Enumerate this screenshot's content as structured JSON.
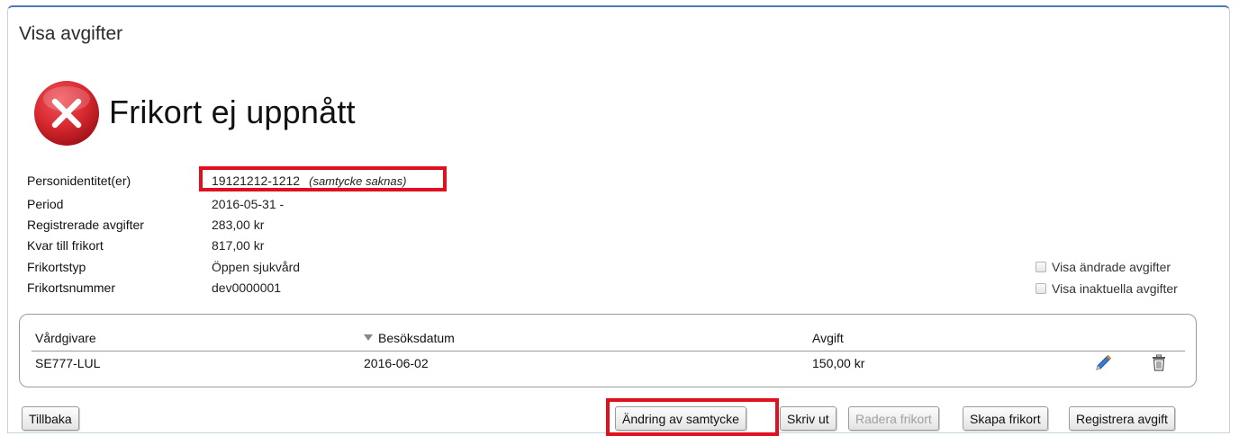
{
  "window": {
    "title": "Visa avgifter"
  },
  "status": {
    "title": "Frikort ej uppnått",
    "icon": "error-x-icon",
    "color": "#d7282f"
  },
  "info": {
    "rows": [
      {
        "label": "Personidentitet(er)",
        "value": "19121212-1212",
        "note": "(samtycke saknas)"
      },
      {
        "label": "Period",
        "value": "2016-05-31 -"
      },
      {
        "label": "Registrerade avgifter",
        "value": "283,00 kr"
      },
      {
        "label": "Kvar till frikort",
        "value": "817,00 kr"
      },
      {
        "label": "Frikortstyp",
        "value": "Öppen sjukvård"
      },
      {
        "label": "Frikortsnummer",
        "value": "dev0000001"
      }
    ]
  },
  "filters": {
    "show_changed": {
      "label": "Visa ändrade avgifter",
      "checked": false
    },
    "show_inactive": {
      "label": "Visa inaktuella avgifter",
      "checked": false
    }
  },
  "table": {
    "columns": [
      "Vårdgivare",
      "Besöksdatum",
      "Avgift"
    ],
    "sorted_column": "Besöksdatum",
    "rows": [
      {
        "provider": "SE777-LUL",
        "date": "2016-06-02",
        "fee": "150,00 kr",
        "actions": [
          "edit-pencil-icon",
          "delete-trash-icon"
        ]
      }
    ]
  },
  "buttons": {
    "back": "Tillbaka",
    "consent_change": "Ändring av samtycke",
    "print": "Skriv ut",
    "delete_card": "Radera frikort",
    "create_card": "Skapa frikort",
    "register_fee": "Registrera avgift"
  },
  "colors": {
    "highlight": "#e0101f",
    "accent": "#4a79b5"
  }
}
